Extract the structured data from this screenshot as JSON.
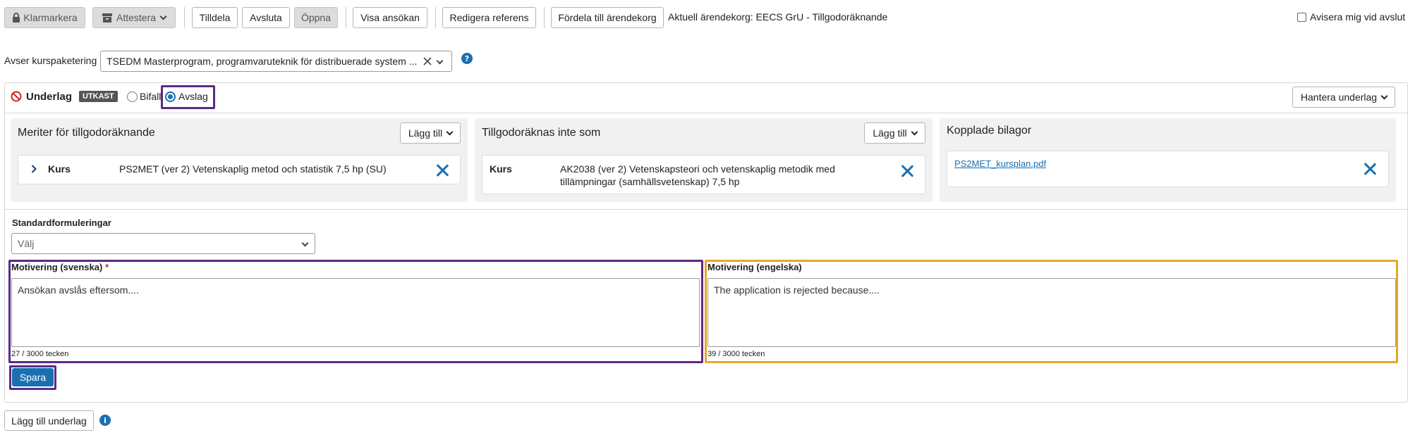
{
  "toolbar": {
    "klarmarkera": "Klarmarkera",
    "attestera": "Attestera",
    "tilldela": "Tilldela",
    "avsluta": "Avsluta",
    "oppna": "Öppna",
    "visa_ansokan": "Visa ansökan",
    "redigera_referens": "Redigera referens",
    "fordela": "Fördela till ärendekorg",
    "current_basket": "Aktuell ärendekorg: EECS GrU - Tillgodoräknande",
    "notify_label": "Avisera mig vid avslut"
  },
  "kurspaketering": {
    "label": "Avser kurspaketering",
    "value": "TSEDM Masterprogram, programvaruteknik för distribuerade system ..."
  },
  "underlag": {
    "title": "Underlag",
    "badge": "UTKAST",
    "option_bifall": "Bifall",
    "option_avslag": "Avslag",
    "selected": "Avslag",
    "manage_button": "Hantera underlag"
  },
  "meriter": {
    "title": "Meriter för tillgodoräknande",
    "add_button": "Lägg till",
    "item_type": "Kurs",
    "item_text": "PS2MET (ver 2) Vetenskaplig metod och statistik 7,5 hp (SU)"
  },
  "inte_som": {
    "title": "Tillgodoräknas inte som",
    "add_button": "Lägg till",
    "item_type": "Kurs",
    "item_line1": "AK2038 (ver 2) Vetenskapsteori och vetenskaplig metodik med",
    "item_line2": "tillämpningar (samhällsvetenskap) 7,5 hp"
  },
  "bilagor": {
    "title": "Kopplade bilagor",
    "file": "PS2MET_kursplan.pdf"
  },
  "standard": {
    "label": "Standardformuleringar",
    "placeholder": "Välj"
  },
  "motivering_sv": {
    "label": "Motivering (svenska)",
    "required_mark": "*",
    "value": "Ansökan avslås eftersom....",
    "counter": "27 / 3000 tecken"
  },
  "motivering_en": {
    "label": "Motivering (engelska)",
    "value": "The application is rejected because....",
    "counter": "39 / 3000 tecken"
  },
  "save_button": "Spara",
  "add_underlag_button": "Lägg till underlag",
  "colors": {
    "accent": "#1a6fb0",
    "highlight_purple": "#5b2a86",
    "highlight_orange": "#e9a52a",
    "ban_red": "#c62828"
  }
}
